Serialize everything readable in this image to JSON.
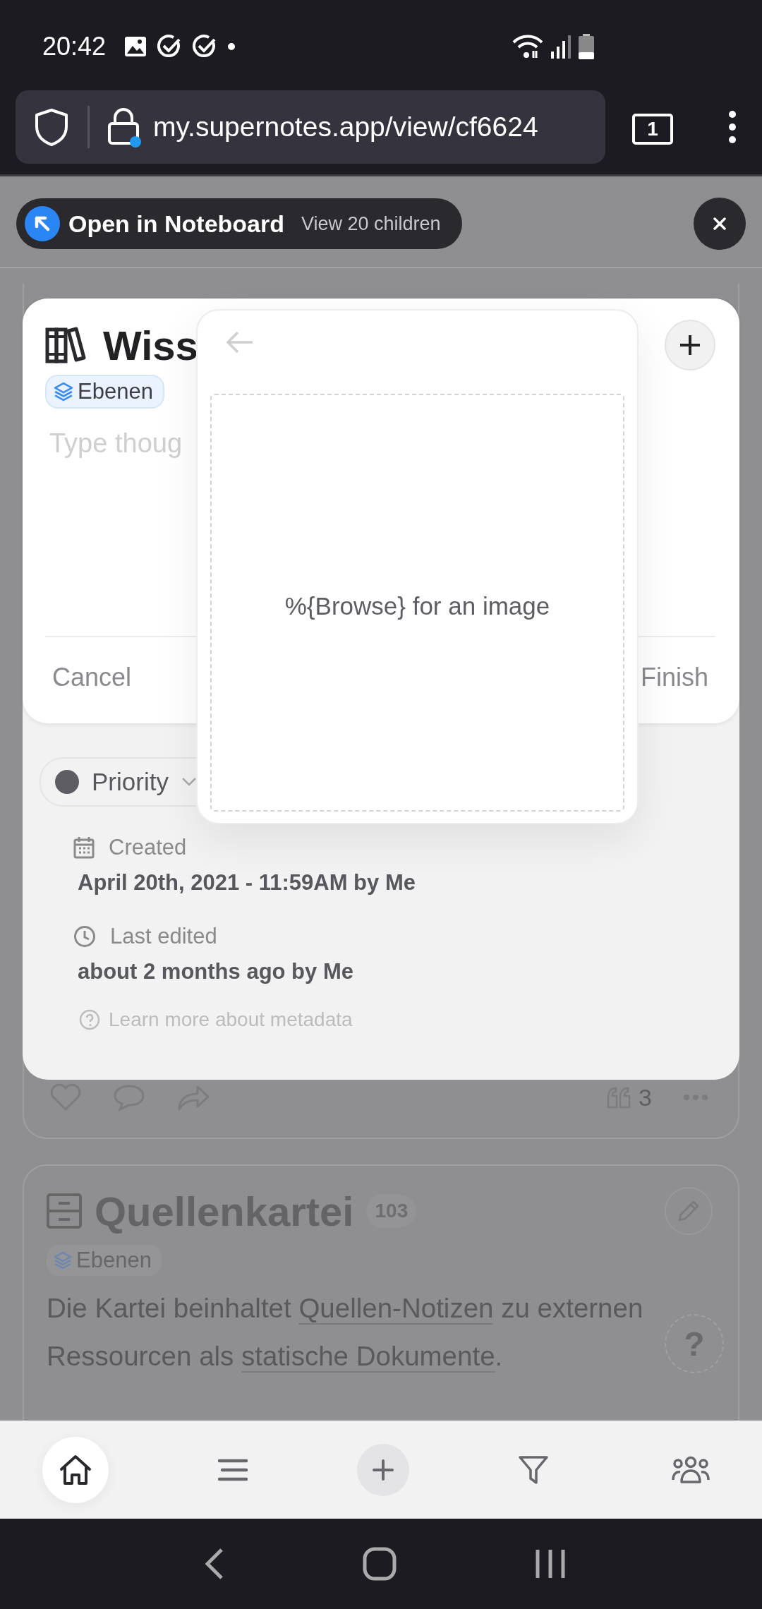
{
  "status_bar": {
    "time": "20:42"
  },
  "browser": {
    "url": "my.supernotes.app/view/cf6624",
    "tab_count": "1"
  },
  "banner": {
    "title": "Open in Noteboard",
    "subtitle": "View 20 children"
  },
  "background_card": {
    "quote_count": "3"
  },
  "help_button": "?",
  "cards": [
    {
      "title": "Quellenkartei",
      "count": "103",
      "tag": "Ebenen",
      "body": [
        {
          "text": "Die Kartei beinhaltet ",
          "link": false
        },
        {
          "text": "Quellen-Notizen",
          "link": true
        },
        {
          "text": " zu externen Ressourcen als ",
          "link": false
        },
        {
          "text": "statische Dokumente",
          "link": true
        },
        {
          "text": ".",
          "link": false
        }
      ]
    }
  ],
  "metadata": {
    "priority": "Priority",
    "created_label": "Created",
    "created_value": "April 20th, 2021 - 11:59AM by **Me**",
    "edited_label": "Last edited",
    "edited_value": "about 2 months ago by **Me**",
    "learn_more": "Learn more about metadata"
  },
  "editor": {
    "title": "Wiss",
    "tag": "Ebenen",
    "placeholder": "Type thoug",
    "cancel": "Cancel",
    "finish": "Finish"
  },
  "image_picker": {
    "prompt": "%{Browse} for an image"
  },
  "nav": [
    {
      "kind": "home",
      "selected": true
    },
    {
      "kind": "list",
      "selected": false
    },
    {
      "kind": "add",
      "selected": false
    },
    {
      "kind": "filter",
      "selected": false
    },
    {
      "kind": "people",
      "selected": false
    }
  ]
}
